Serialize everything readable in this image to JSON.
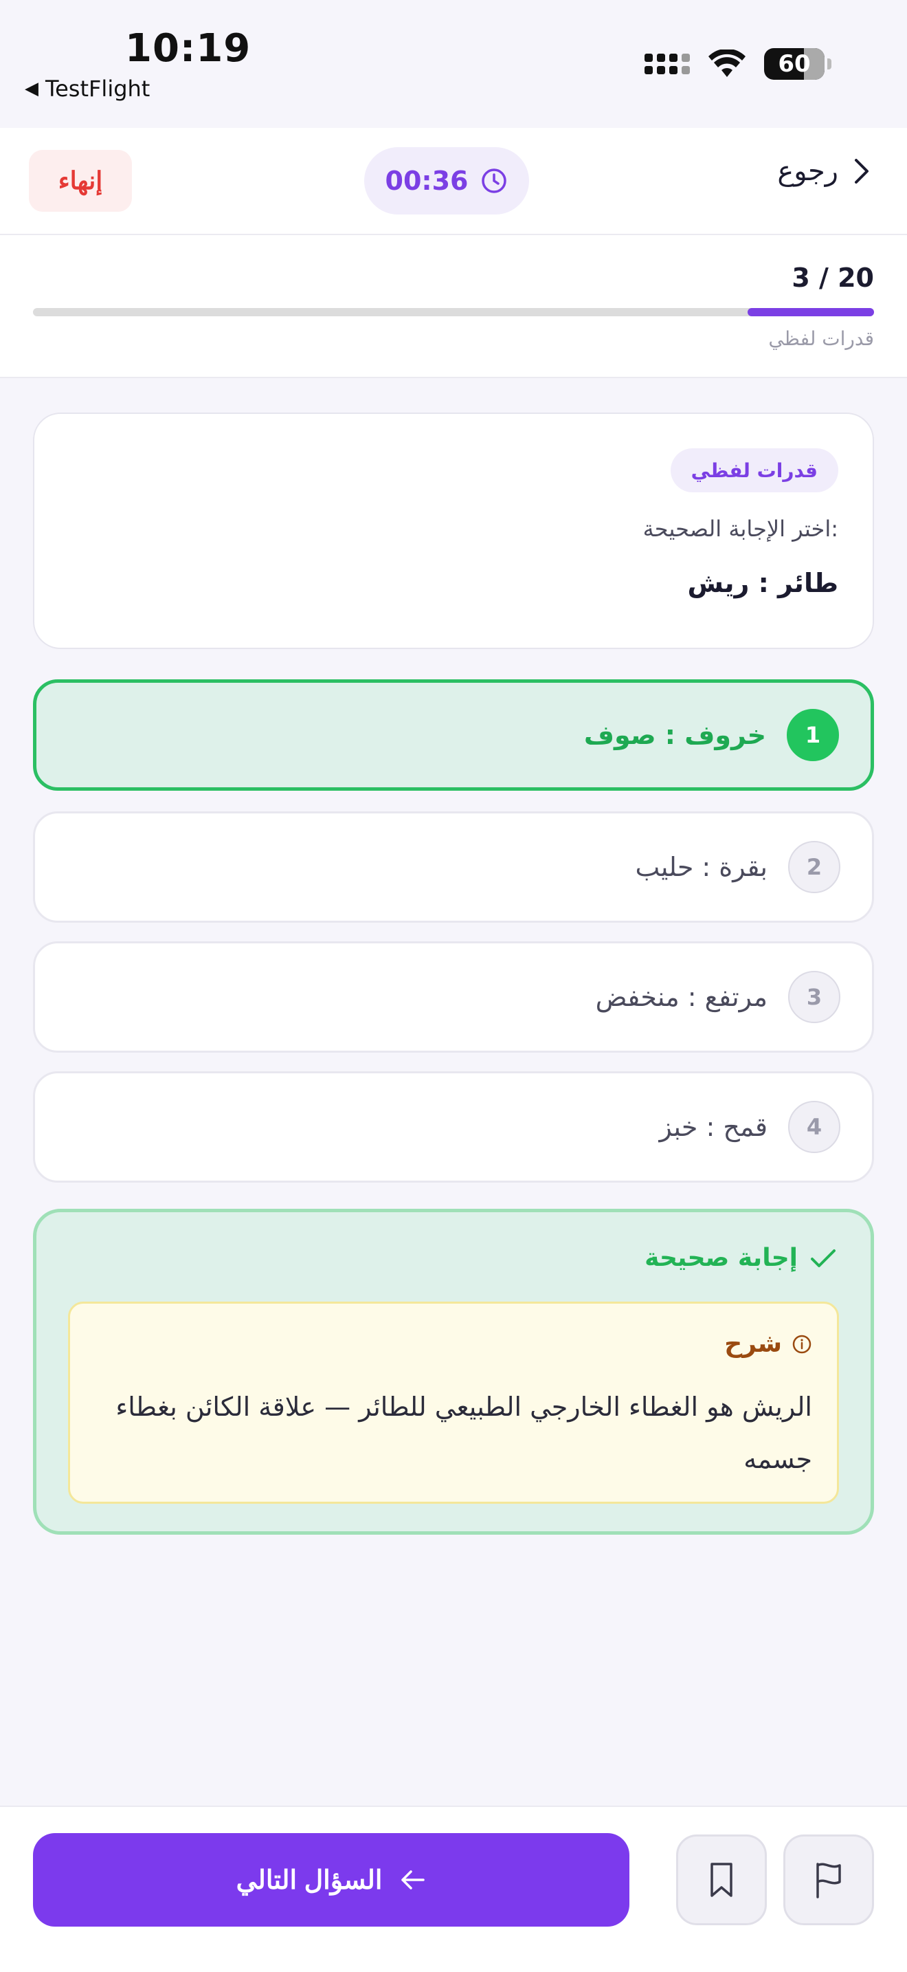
{
  "status_bar": {
    "time": "10:19",
    "back_app": "TestFlight",
    "battery": "60"
  },
  "header": {
    "end_label": "إنهاء",
    "timer": "00:36",
    "back_label": "رجوع"
  },
  "progress": {
    "count": "3 / 20",
    "current": 3,
    "total": 20,
    "category": "قدرات لفظي"
  },
  "question": {
    "tag": "قدرات لفظي",
    "instruction": "اختر الإجابة الصحيحة:",
    "text": "طائر : ريش"
  },
  "options": [
    {
      "num": "1",
      "text": "خروف : صوف",
      "state": "correct"
    },
    {
      "num": "2",
      "text": "بقرة : حليب",
      "state": "default"
    },
    {
      "num": "3",
      "text": "مرتفع : منخفض",
      "state": "default"
    },
    {
      "num": "4",
      "text": "قمح : خبز",
      "state": "default"
    }
  ],
  "feedback": {
    "title": "إجابة صحيحة",
    "explanation_title": "شرح",
    "explanation_text": "الريش هو الغطاء الخارجي الطبيعي للطائر — علاقة الكائن بغطاء جسمه"
  },
  "bottom": {
    "next_label": "السؤال التالي"
  },
  "colors": {
    "accent": "#7c3aed",
    "correct": "#22c55e",
    "danger": "#e53935"
  },
  "icons": {
    "timer": "clock-icon",
    "back": "chevron-right-icon",
    "check": "check-icon",
    "info": "info-icon",
    "next": "arrow-left-icon",
    "bookmark": "bookmark-icon",
    "flag": "flag-icon"
  }
}
